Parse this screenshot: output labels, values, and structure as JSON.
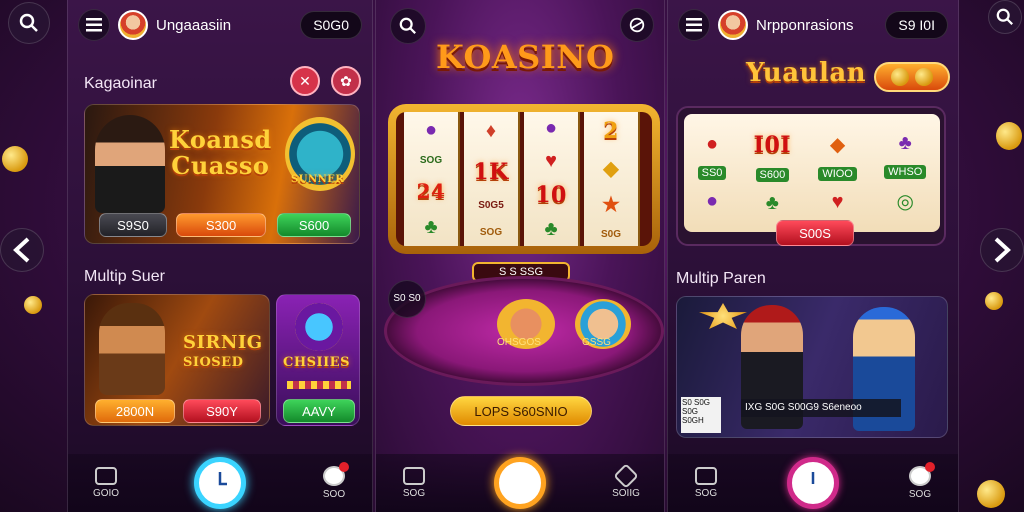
{
  "nav": {
    "prev_icon": "chevron-left-icon",
    "next_icon": "chevron-right-icon"
  },
  "panel1": {
    "title": "Ungaaasiin",
    "balance": "S0G0",
    "section1": "Kagaoinar",
    "featured": {
      "title_line1": "Koansd",
      "title_line2": "Cuasso",
      "badge": "SUNNER",
      "buttons": [
        "S9S0",
        "S300",
        "S600"
      ]
    },
    "section2": "Multip Suer",
    "game_a": {
      "title_line1": "SIRNIG",
      "title_line2": "SIOSED",
      "buttons": [
        "2800N",
        "S90Y"
      ]
    },
    "game_b": {
      "title": "CHSIIES",
      "button": "AAVY"
    },
    "bottom": {
      "left_label": "GOIO",
      "right_label": "SOO"
    }
  },
  "panel2": {
    "logo": "KOASINO",
    "reels": [
      [
        "",
        "SOG",
        "24",
        ""
      ],
      [
        "",
        "1K",
        "S0G5",
        "SOG"
      ],
      [
        "",
        "",
        "10",
        ""
      ],
      [
        "2",
        "",
        "",
        "S0G"
      ]
    ],
    "win_display": "S S SSG",
    "badge": "S0 S0",
    "table_labels": [
      "OHSGOS",
      "GSSG"
    ],
    "cta": "LOPS S60SNIO",
    "bottom": {
      "left_label": "SOG",
      "right_label": "SOIIG"
    }
  },
  "panel3": {
    "title": "Nrpponrasions",
    "balance": "S9 I0I",
    "logo": "Yuaulan",
    "reel_labels": [
      "SS0",
      "S600",
      "WIOO",
      "WHSO"
    ],
    "reel_button": "S00S",
    "section": "Multip Paren",
    "promo_badge": "",
    "promo_text": "IXG S0G S00G9 S6eneoo",
    "promo_side": "S0 S0G S0G S0GH",
    "bottom": {
      "left_label": "SOG",
      "right_label": "SOG"
    }
  }
}
